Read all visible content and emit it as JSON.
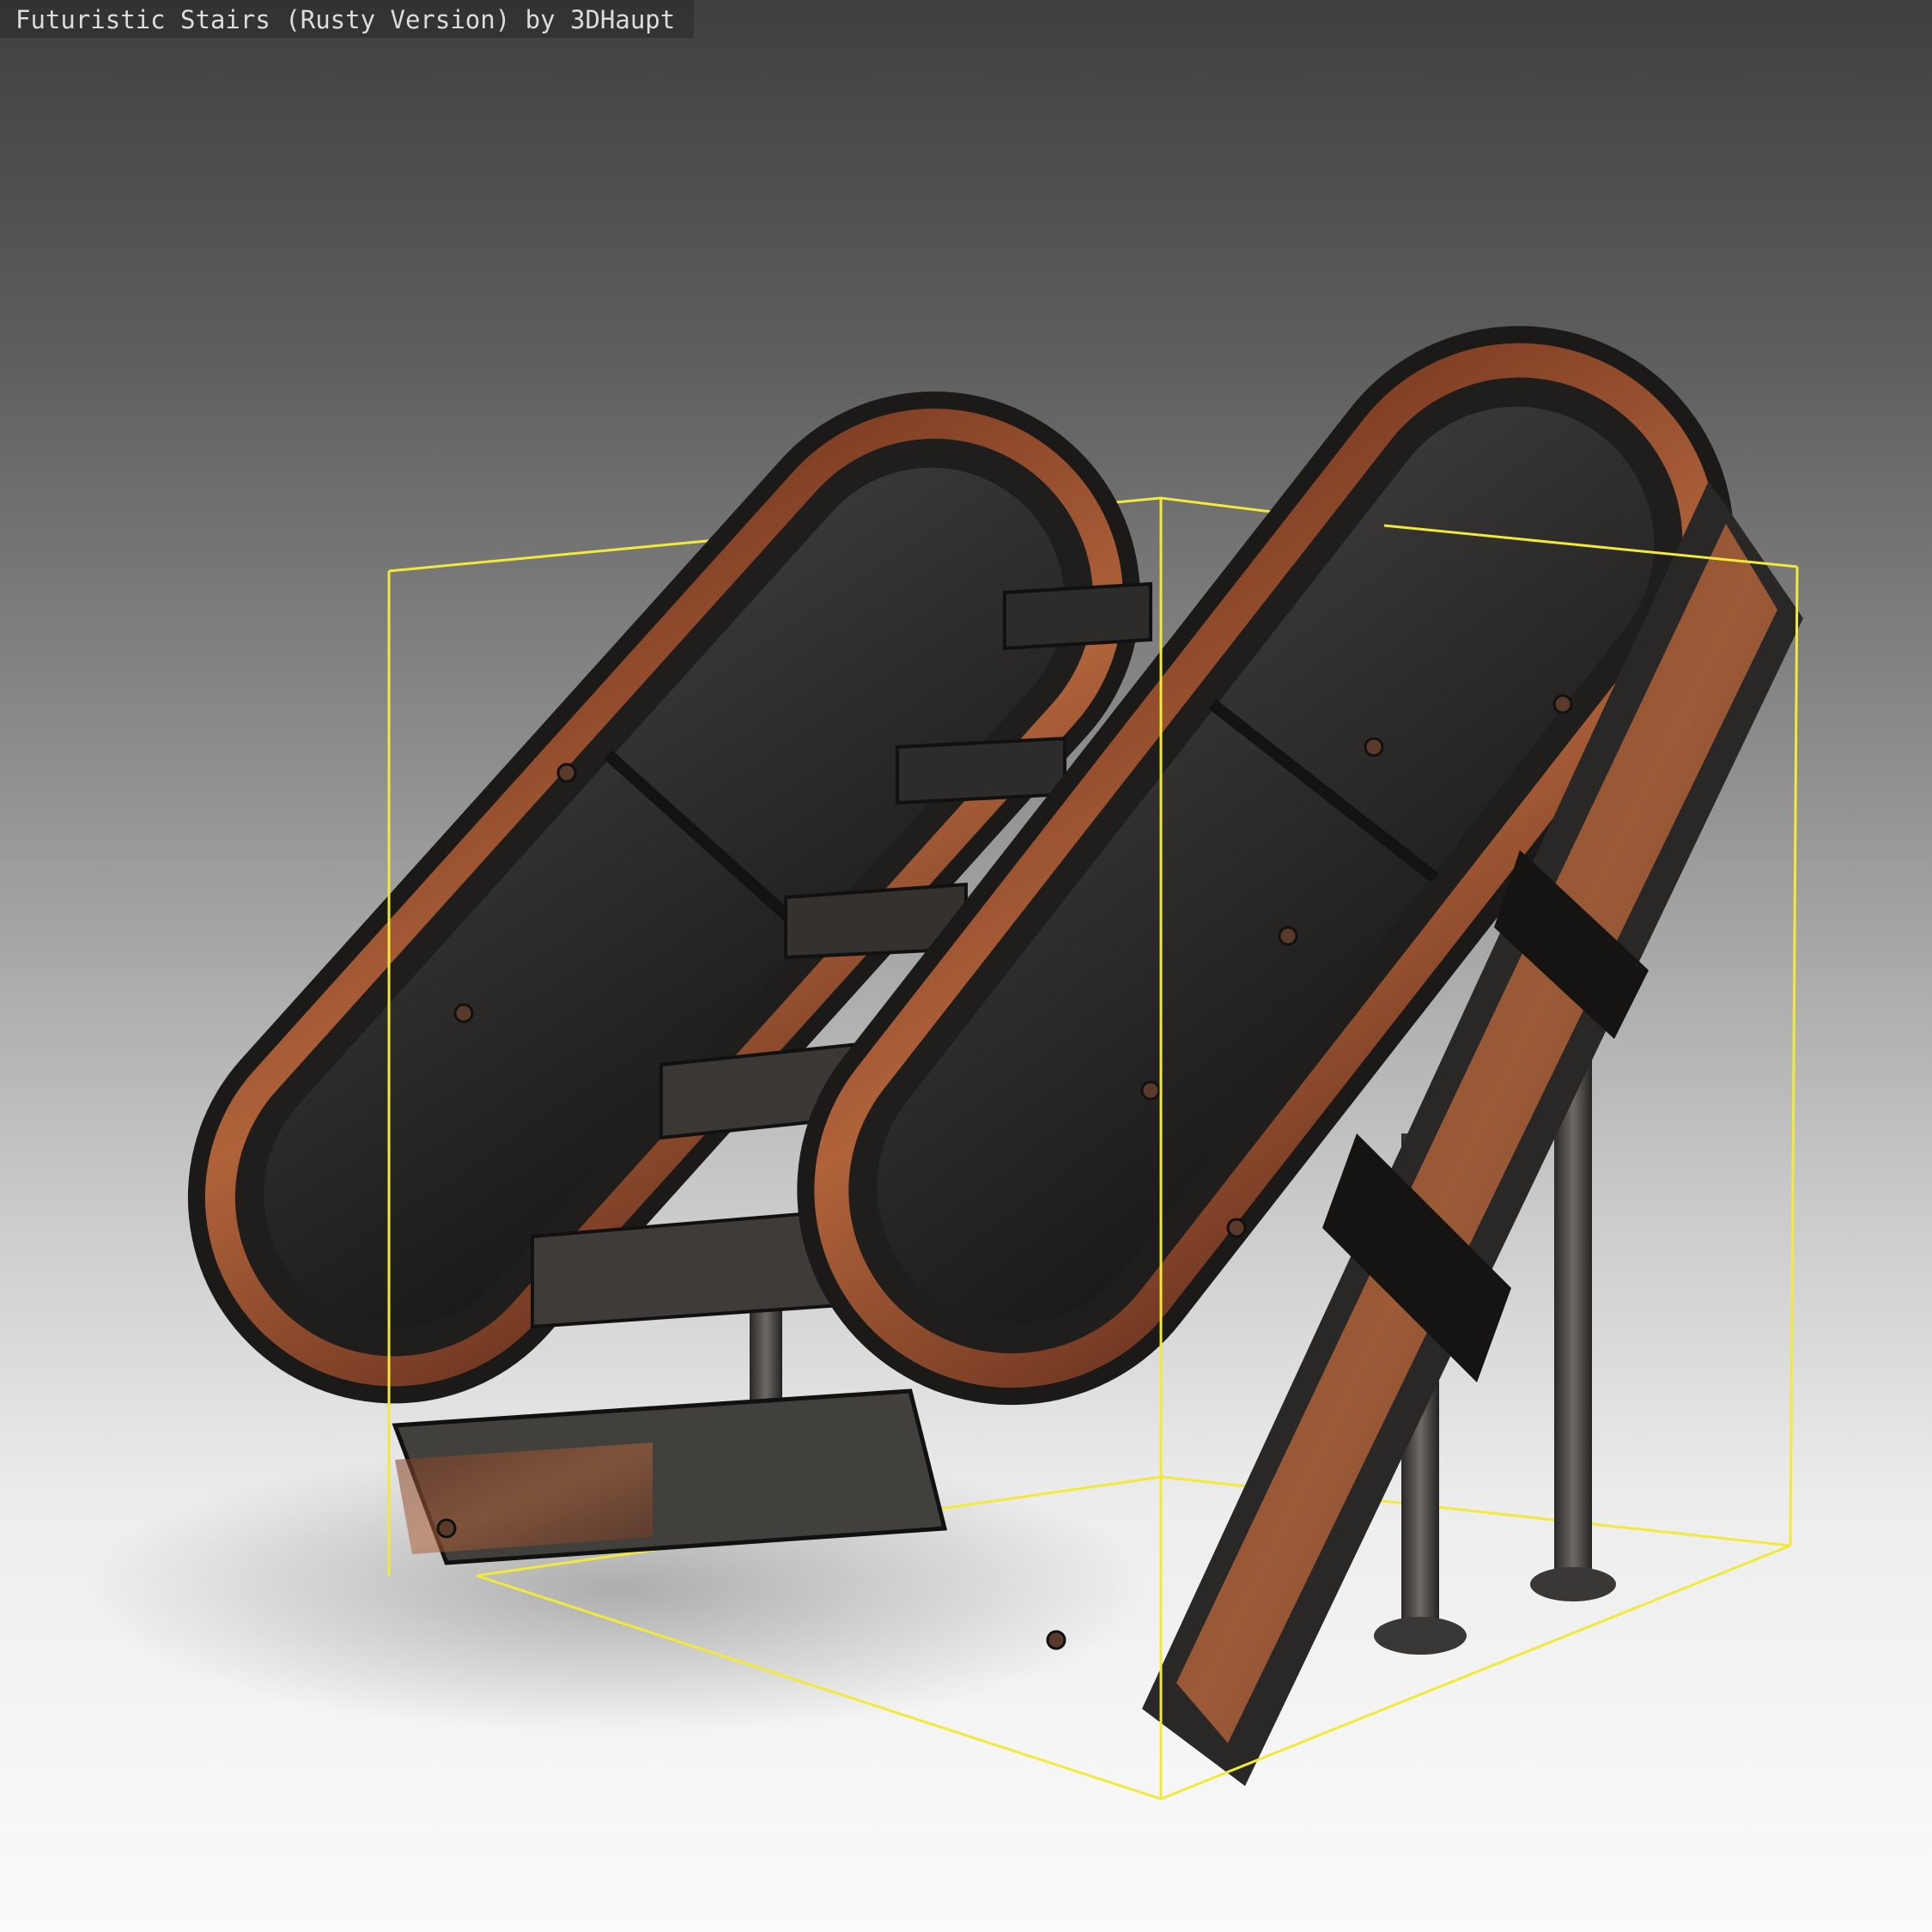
{
  "viewer": {
    "title": "Futuristic Stairs (Rusty Version) by 3DHaupt",
    "background_top": "#3f3f3f",
    "background_bottom": "#fbfbfb",
    "bounding_box_color": "#f2ea3a"
  },
  "model": {
    "name": "futuristic-stairs",
    "material_colors": {
      "dark_metal": "#2b2a29",
      "rust": "#a0532e",
      "steel_highlight": "#8a8784"
    }
  }
}
